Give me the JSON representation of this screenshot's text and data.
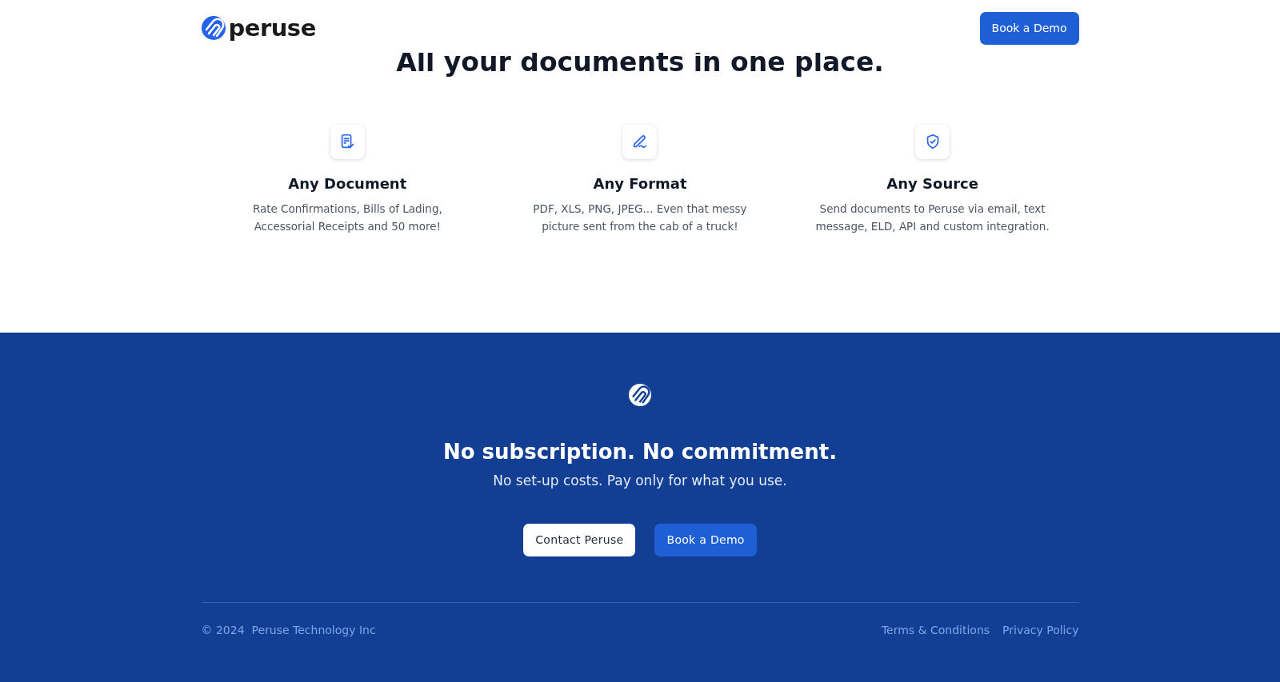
{
  "header": {
    "logo_text": "peruse",
    "button": "Book a Demo"
  },
  "heading": "All your documents in one place.",
  "features": [
    {
      "title": "Any Document",
      "description": "Rate Confirmations, Bills of Lading, Accessorial Receipts and 50 more!"
    },
    {
      "title": "Any Format",
      "description": "PDF, XLS, PNG, JPEG... Even that messy picture sent from the cab of a truck!"
    },
    {
      "title": "Any Source",
      "description": "Send documents to Peruse via email, text message, ELD, API and custom integration."
    }
  ],
  "cta": {
    "title": "No subscription. No commitment.",
    "subtitle": "No set-up costs. Pay only for what you use.",
    "buttons": [
      {
        "label": "Contact Peruse",
        "kind": "light"
      },
      {
        "label": "Book a Demo",
        "kind": "primary"
      }
    ]
  },
  "footer": {
    "copyright": "© 2024  Peruse Technology Inc",
    "links": [
      "Terms & Conditions",
      "Privacy Policy"
    ]
  }
}
